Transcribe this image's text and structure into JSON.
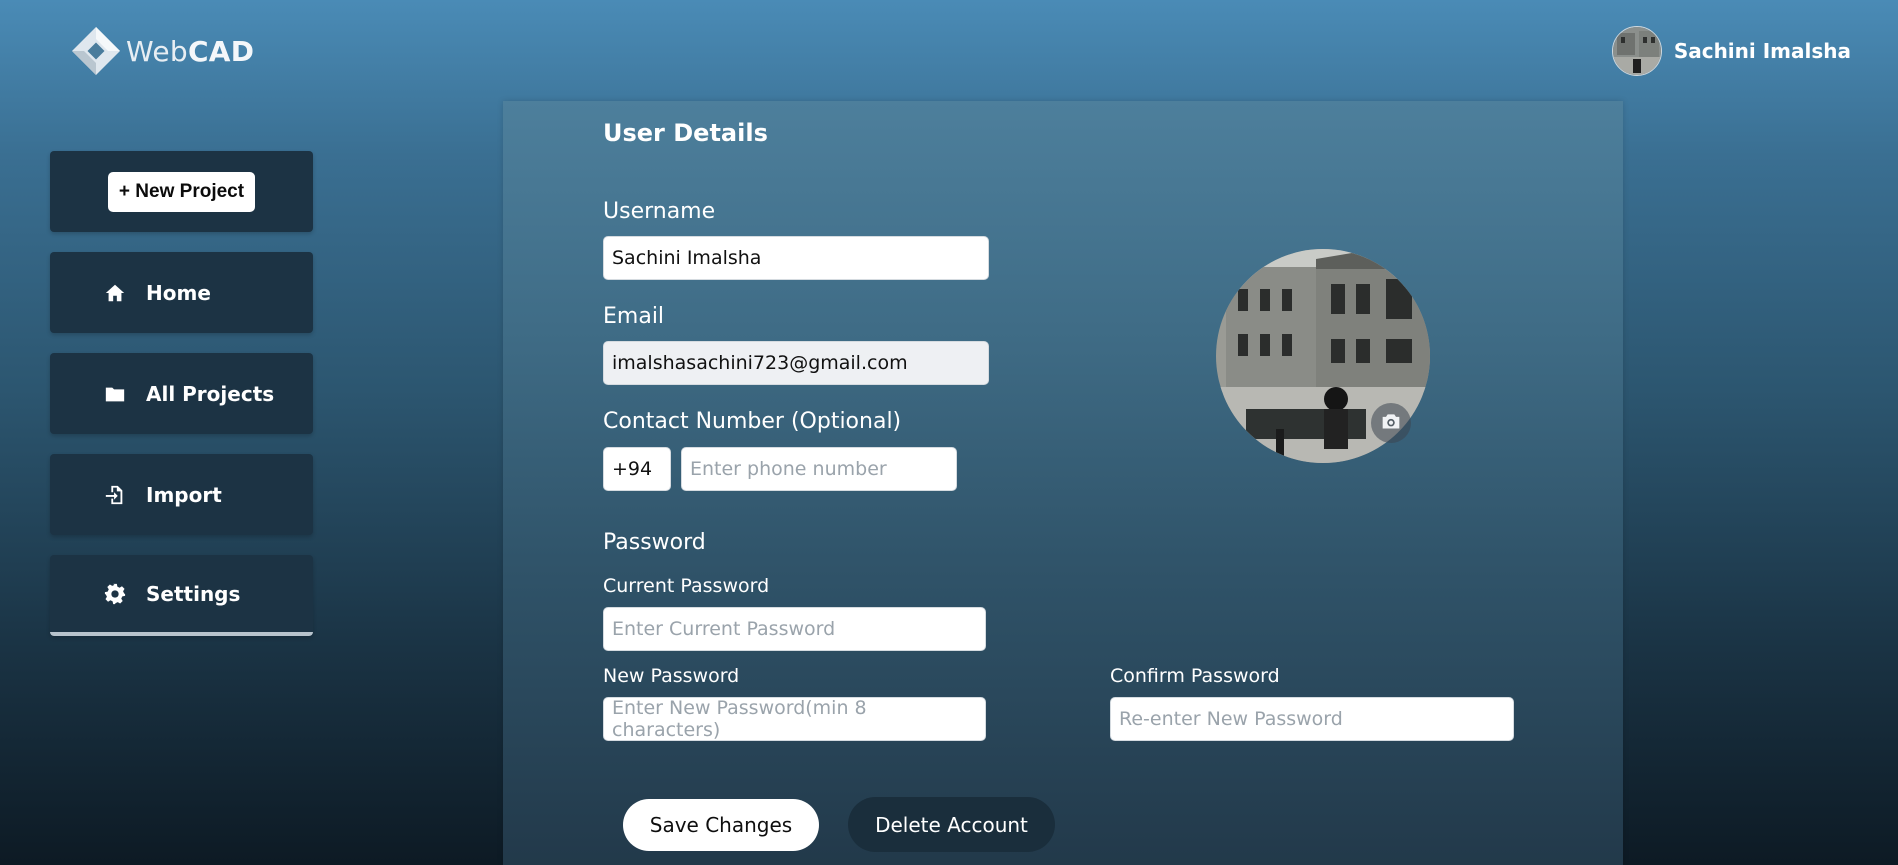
{
  "brand": {
    "name_light": "Web",
    "name_bold": "CAD"
  },
  "user": {
    "name": "Sachini Imalsha"
  },
  "sidebar": {
    "new_project_label": "+ New Project",
    "items": [
      {
        "label": "Home",
        "icon": "home-icon"
      },
      {
        "label": "All Projects",
        "icon": "folder-icon"
      },
      {
        "label": "Import",
        "icon": "import-icon"
      },
      {
        "label": "Settings",
        "icon": "gear-icon"
      }
    ]
  },
  "form": {
    "title": "User Details",
    "username_label": "Username",
    "username_value": "Sachini Imalsha",
    "email_label": "Email",
    "email_value": "imalshasachini723@gmail.com",
    "contact_label": "Contact Number (Optional)",
    "country_code": "+94",
    "phone_placeholder": "Enter phone number",
    "password_heading": "Password",
    "current_password_label": "Current Password",
    "current_password_placeholder": "Enter Current Password",
    "new_password_label": "New Password",
    "new_password_placeholder": "Enter New Password(min 8 characters)",
    "confirm_password_label": "Confirm Password",
    "confirm_password_placeholder": "Re-enter New Password",
    "save_label": "Save Changes",
    "delete_label": "Delete Account"
  },
  "colors": {
    "sidebar_card": "#1c3344",
    "delete_button": "#1a2e3c",
    "accent": "#4a8bb6"
  }
}
